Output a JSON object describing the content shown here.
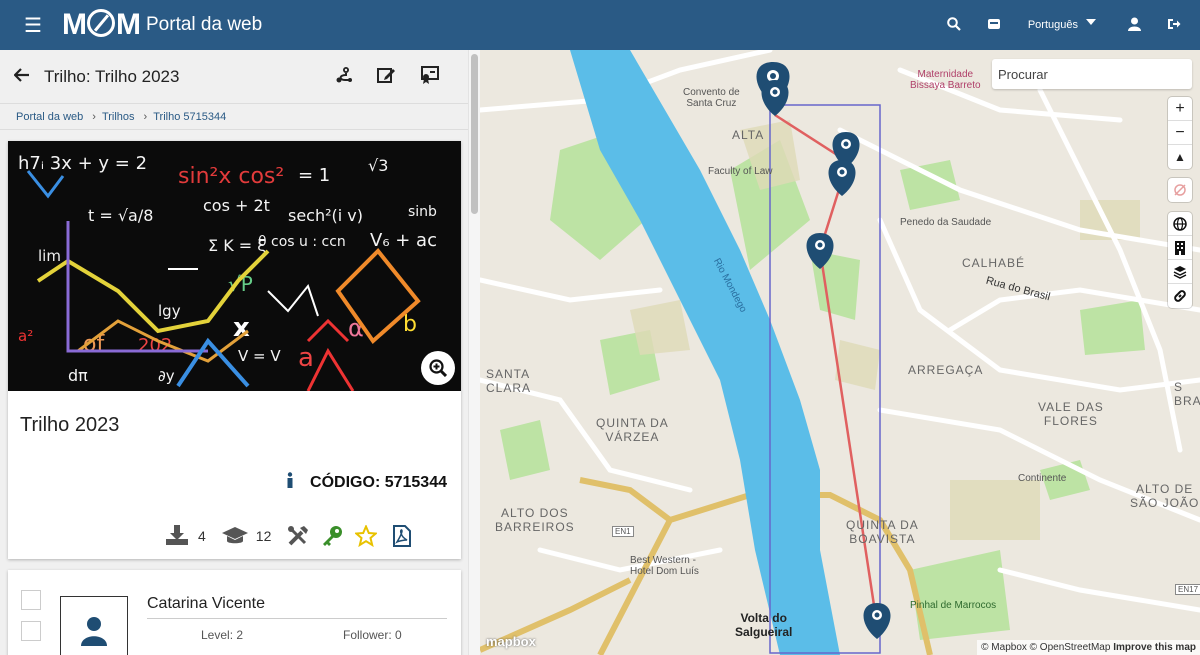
{
  "header": {
    "logo_text": "MCM",
    "title": "Portal da web",
    "language": "Português"
  },
  "page": {
    "title": "Trilho: Trilho 2023"
  },
  "breadcrumb": [
    "Portal da web",
    "Trilhos",
    "Trilho 5715344"
  ],
  "trail": {
    "name": "Trilho 2023",
    "code_label": "CÓDIGO: 5715344",
    "downloads": "4",
    "students": "12"
  },
  "user": {
    "name": "Catarina Vicente",
    "level": "Level: 2",
    "followers": "Follower: 0"
  },
  "map": {
    "search_placeholder": "Procurar",
    "attribution": "© Mapbox © OpenStreetMap",
    "improve": "Improve this map",
    "logo": "mapbox",
    "labels": [
      {
        "text": "Convento de\nSanta Cruz"
      },
      {
        "text": "Maternidade\nBissaya Barreto"
      },
      {
        "text": "ALTA"
      },
      {
        "text": "Faculty of Law"
      },
      {
        "text": "Penedo da Saudade"
      },
      {
        "text": "CALHABÉ"
      },
      {
        "text": "Rua do Brasil"
      },
      {
        "text": "Rio Mondego"
      },
      {
        "text": "SANTA\nCLARA"
      },
      {
        "text": "ARREGAÇA"
      },
      {
        "text": "VALE DAS\nFLORES"
      },
      {
        "text": "QUINTA DA\nVÁRZEA"
      },
      {
        "text": "Continente"
      },
      {
        "text": "ALTO DE\nSÃO JOÃO"
      },
      {
        "text": "ALTO DOS\nBARREIROS"
      },
      {
        "text": "EN1"
      },
      {
        "text": "Best Western -\nHotel Dom Luís"
      },
      {
        "text": "QUINTA DA\nBOAVISTA"
      },
      {
        "text": "Volta do\nSalgueiral"
      },
      {
        "text": "Pinhal de Marrocos"
      },
      {
        "text": "EN17"
      },
      {
        "text": "S\nBRA"
      }
    ]
  },
  "colors": {
    "header": "#2a5a85",
    "river": "#5bbde8",
    "route": "#e06060",
    "pin": "#1f4d73",
    "bbox": "#6666cc"
  }
}
